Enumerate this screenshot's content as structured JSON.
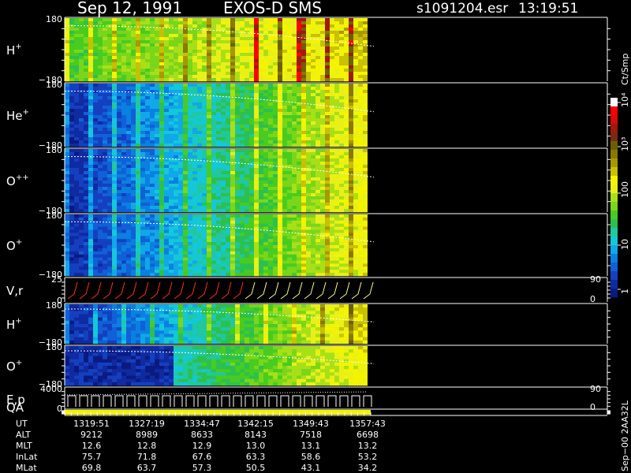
{
  "header": {
    "date": "Sep 12, 1991",
    "instrument": "EXOS-D SMS",
    "file": "s1091204.esr",
    "time": "13:19:51"
  },
  "colorbar": {
    "unit_label": "Ct/Smp",
    "tick_labels": [
      "1",
      "10",
      "100",
      "10³",
      "10⁴"
    ],
    "colors": [
      "#0a1a80",
      "#102aa0",
      "#1440c0",
      "#1060d8",
      "#0a80e0",
      "#10a8e8",
      "#14c8d8",
      "#20c8a0",
      "#2cc050",
      "#48cc20",
      "#7ad61a",
      "#a8e018",
      "#e8f018",
      "#f4f400",
      "#c8c000",
      "#a89800",
      "#887800",
      "#6a6000",
      "#7a2a10",
      "#a01810",
      "#d80c0c",
      "#ff0000",
      "#ffffff"
    ]
  },
  "panels": [
    {
      "label": "H",
      "sup": "+",
      "ytop": "180",
      "ybot": "−180"
    },
    {
      "label": "He",
      "sup": "+",
      "ytop": "180",
      "ybot": "−180"
    },
    {
      "label": "O",
      "sup": "++",
      "ytop": "180",
      "ybot": "−180"
    },
    {
      "label": "O",
      "sup": "+",
      "ytop": "180",
      "ybot": "−180"
    },
    {
      "label": "V,r",
      "sup": "",
      "ytop": "25",
      "ybot": "0",
      "rtop": "90",
      "rbot": "0"
    },
    {
      "label": "H",
      "sup": "+",
      "ytop": "180",
      "ybot": "−180"
    },
    {
      "label": "O",
      "sup": "+",
      "ytop": "180",
      "ybot": "−180"
    },
    {
      "label": "E,p",
      "sup": "",
      "ytop": "4000",
      "ybot": "0",
      "rtop": "90",
      "rbot": "0"
    },
    {
      "label": "QA",
      "sup": "",
      "ytop": "",
      "ybot": ""
    }
  ],
  "footer": {
    "row_labels": [
      "UT",
      "ALT",
      "MLT",
      "InLat",
      "MLat"
    ],
    "columns": [
      [
        "1319:51",
        "9212",
        "12.6",
        "75.7",
        "69.8"
      ],
      [
        "1327:19",
        "8989",
        "12.8",
        "71.8",
        "63.7"
      ],
      [
        "1334:47",
        "8633",
        "12.9",
        "67.6",
        "57.3"
      ],
      [
        "1342:15",
        "8143",
        "13.0",
        "63.3",
        "50.5"
      ],
      [
        "1349:43",
        "7518",
        "13.1",
        "58.6",
        "43.1"
      ],
      [
        "1357:43",
        "6698",
        "13.2",
        "53.2",
        "34.2"
      ]
    ]
  },
  "side_text": "Sep−00  2AA32L",
  "chart_data": {
    "type": "heatmap",
    "title": "Sep 12, 1991   EXOS-D SMS",
    "x": [
      "1319:51",
      "1327:19",
      "1334:47",
      "1342:15",
      "1349:43",
      "1357:43"
    ],
    "xlabel": "UT",
    "colorscale": "log",
    "colorbar_range": [
      1,
      10000
    ],
    "colorbar_unit": "Ct/Smp",
    "series": [
      {
        "name": "H+",
        "ylim": [
          -180,
          180
        ]
      },
      {
        "name": "He+",
        "ylim": [
          -180,
          180
        ]
      },
      {
        "name": "O++",
        "ylim": [
          -180,
          180
        ]
      },
      {
        "name": "O+",
        "ylim": [
          -180,
          180
        ]
      },
      {
        "name": "V,r",
        "ylim": [
          0,
          25
        ],
        "right_ylim": [
          0,
          90
        ]
      },
      {
        "name": "H+",
        "ylim": [
          -180,
          180
        ]
      },
      {
        "name": "O+",
        "ylim": [
          -180,
          180
        ]
      },
      {
        "name": "E,p",
        "ylim": [
          0,
          4000
        ],
        "right_ylim": [
          0,
          90
        ]
      },
      {
        "name": "QA"
      }
    ]
  }
}
